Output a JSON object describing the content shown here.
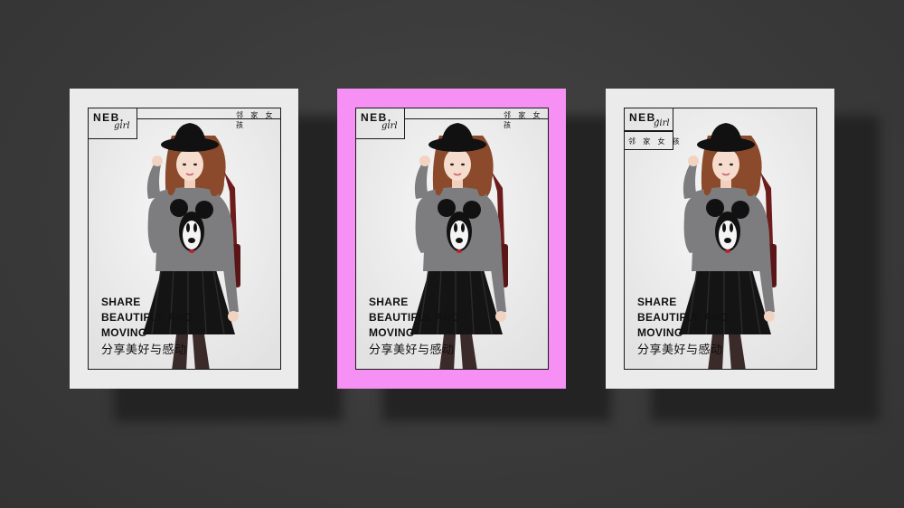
{
  "colors": {
    "background": "#3b3b3b",
    "card_gray": "#ebebeb",
    "card_pink": "#f690f5",
    "sweater": "#7d7d80",
    "skirt": "#141414",
    "hair": "#8a4a2b",
    "bag": "#6d1c1c"
  },
  "cards": [
    {
      "logo_main": "NEB.",
      "logo_script": "girl",
      "tagline_cn": "邻 家 女 孩",
      "text_lines": [
        "SHARE",
        "BEAUTIFUL AND",
        "MOVING"
      ],
      "cn_line": "分享美好与感动",
      "variant": "gray-tagline-top"
    },
    {
      "logo_main": "NEB.",
      "logo_script": "girl",
      "tagline_cn": "邻 家 女 孩",
      "text_lines": [
        "SHARE",
        "BEAUTIFUL AND",
        "MOVING"
      ],
      "cn_line": "分享美好与感动",
      "variant": "pink-tagline-top"
    },
    {
      "logo_main": "NEB.",
      "logo_script": "girl",
      "tagline_cn": "邻 家 女 孩",
      "text_lines": [
        "SHARE",
        "BEAUTIFUL AND",
        "MOVING"
      ],
      "cn_line": "分享美好与感动",
      "variant": "gray-tagline-below"
    }
  ]
}
